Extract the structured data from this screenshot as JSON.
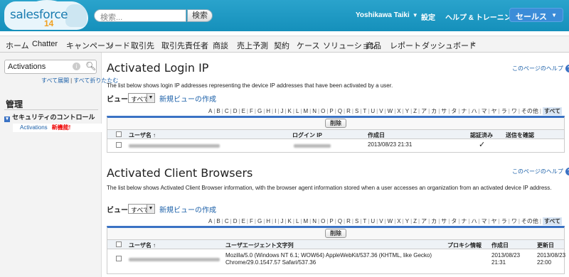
{
  "header": {
    "logo_brand": "salesforce",
    "logo_version": "14",
    "search_placeholder": "検索...",
    "search_button": "検索",
    "user_name": "Yoshikawa Taiki",
    "settings": "設定",
    "help_training": "ヘルプ & トレーニング",
    "app": "セールス",
    "colors": {
      "header_bg": "#1797c0",
      "accent": "#3a72c4",
      "new_badge": "#e00000"
    }
  },
  "tabs": [
    "ホーム",
    "Chatter",
    "キャンペーン",
    "リード",
    "取引先",
    "取引先責任者",
    "商談",
    "売上予測",
    "契約",
    "ケース",
    "ソリューション",
    "商品",
    "レポート",
    "ダッシュボード",
    "+"
  ],
  "sidebar": {
    "quickfind_value": "Activations",
    "expand_all": "すべて展開",
    "collapse_all": "すべて折りたたむ",
    "title": "管理",
    "section": "セキュリティのコントロール",
    "item": "Activations",
    "item_badge": "新機能!"
  },
  "help_page_link": "このページのヘルプ",
  "alphabet": [
    "A",
    "B",
    "C",
    "D",
    "E",
    "F",
    "G",
    "H",
    "I",
    "J",
    "K",
    "L",
    "M",
    "N",
    "O",
    "P",
    "Q",
    "R",
    "S",
    "T",
    "U",
    "V",
    "W",
    "X",
    "Y",
    "Z",
    "ア",
    "カ",
    "サ",
    "タ",
    "ナ",
    "ハ",
    "マ",
    "ヤ",
    "ラ",
    "ワ",
    "その他",
    "すべて"
  ],
  "view_label": "ビュー:",
  "view_value": "すべて",
  "new_view": "新規ビューの作成",
  "delete_button": "削除",
  "ip_section": {
    "title": "Activated Login IP",
    "description": "The list below shows login IP addresses representing the device IP addresses that have been activated by a user.",
    "columns": [
      "ユーザ名 ↑",
      "ログイン IP",
      "作成日",
      "認証済み",
      "送信を確認"
    ],
    "rows": [
      {
        "created": "2013/08/23 21:31",
        "verified": "✓"
      }
    ]
  },
  "browser_section": {
    "title": "Activated Client Browsers",
    "description": "The list below shows Activated Client Browser information, with the browser agent information stored when a user accesses an organization from an activated device IP address.",
    "columns": [
      "ユーザ名 ↑",
      "ユーザエージェント文字列",
      "プロキシ情報",
      "作成日",
      "更新日"
    ],
    "rows": [
      {
        "user_agent_1": "Mozilla/5.0 (Windows NT 6.1; WOW64) AppleWebKit/537.36 (KHTML, like Gecko)",
        "user_agent_2": "Chrome/29.0.1547.57 Safari/537.36",
        "created_1": "2013/08/23",
        "created_2": "21:31",
        "modified_1": "2013/08/23",
        "modified_2": "22:00"
      }
    ]
  }
}
